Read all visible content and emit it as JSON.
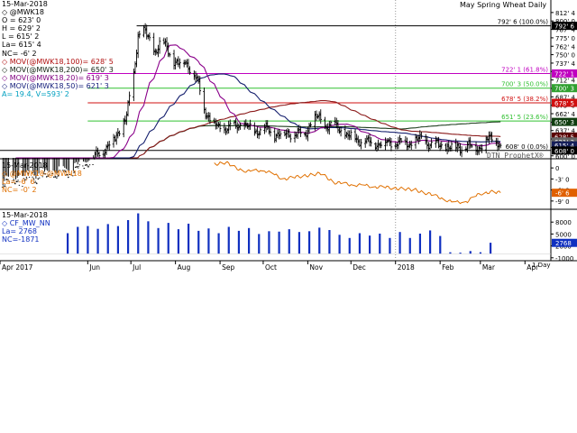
{
  "header": {
    "date": "15-Mar-2018",
    "symbol": "@MWK18",
    "title": "May Spring Wheat Daily"
  },
  "price_legend": {
    "lines": [
      {
        "text": "O = 623' 0",
        "color": "#000000"
      },
      {
        "text": "H = 629' 2",
        "color": "#000000"
      },
      {
        "text": "L = 615' 2",
        "color": "#000000"
      },
      {
        "text": "La= 615' 4",
        "color": "#000000"
      },
      {
        "text": "NC= -6' 2",
        "color": "#000000"
      },
      {
        "text": "MOV(@MWK18,100)= 628' 5",
        "color": "#b01010"
      },
      {
        "text": "MOV(@MWK18,200)= 650' 3",
        "color": "#102010"
      },
      {
        "text": "MOV(@MWK18,20)= 619' 3",
        "color": "#800080"
      },
      {
        "text": "MOV(@MWK18,50)= 621' 3",
        "color": "#1a237e"
      },
      {
        "text": "A= 19.4, V=593' 2",
        "color": "#00a0c0"
      }
    ]
  },
  "spread_legend": {
    "lines": [
      {
        "text": "15-Mar-2018",
        "color": "#000000"
      },
      {
        "text": "@MWK18-@MWN18",
        "color": "#e07000"
      },
      {
        "text": "La= -6' 6",
        "color": "#e07000"
      },
      {
        "text": "NC= -0' 2",
        "color": "#e07000"
      }
    ]
  },
  "oi_legend": {
    "lines": [
      {
        "text": "15-Mar-2018",
        "color": "#000000"
      },
      {
        "text": "CF_MW_NN",
        "color": "#1030c0"
      },
      {
        "text": "La= 2768",
        "color": "#1030c0"
      },
      {
        "text": "NC=-1871",
        "color": "#1030c0"
      }
    ]
  },
  "watermark": "DTN ProphetX®",
  "period_label": "1 Day",
  "colors": {
    "bars": "#000000",
    "ma100": "#8b1a1a",
    "ma200": "#1e3d1e",
    "ma20": "#8a008a",
    "ma50": "#16206e",
    "spread": "#e07000",
    "oi": "#1030c0",
    "badge_price": "#000000",
    "badge_ma100": "#5a0000",
    "badge_ma200": "#0f3d0f",
    "badge_ma20": "#666666",
    "badge_ma50": "#161f5a",
    "badge_spread": "#e06000",
    "badge_oi": "#1030c0"
  },
  "chart_data": [
    {
      "type": "line",
      "subtype": "ohlc-bars",
      "title": "May Spring Wheat Daily",
      "xlabel": "",
      "ylabel": "",
      "ylim": [
        597,
        815
      ],
      "x_tick_labels": [
        "Apr 2017",
        "Jun",
        "Jul",
        "Aug",
        "Sep",
        "Oct",
        "Nov",
        "Dec",
        "2018",
        "Feb",
        "Mar",
        "Apr"
      ],
      "y_tick_labels": [
        "812' 4",
        "800' 0",
        "787' 4",
        "775' 0",
        "762' 4",
        "750' 0",
        "737' 4",
        "725' 0",
        "712' 4",
        "700' 0",
        "687' 4",
        "675' 0",
        "662' 4",
        "650' 0",
        "637' 4",
        "625' 0",
        "612' 4",
        "600' 0"
      ],
      "y_tick_values": [
        812.5,
        800,
        787.5,
        775,
        762.5,
        750,
        737.5,
        725,
        712.5,
        700,
        687.5,
        675,
        662.5,
        650,
        637.5,
        625,
        612.5,
        600
      ],
      "price_anchors": {
        "x": [
          "2017-04-01",
          "2017-05-01",
          "2017-05-20",
          "2017-06-01",
          "2017-06-10",
          "2017-06-20",
          "2017-06-28",
          "2017-07-03",
          "2017-07-06",
          "2017-07-10",
          "2017-07-14",
          "2017-07-18",
          "2017-07-22",
          "2017-07-26",
          "2017-07-31",
          "2017-08-04",
          "2017-08-08",
          "2017-08-12",
          "2017-08-17",
          "2017-08-22",
          "2017-08-28",
          "2017-09-05",
          "2017-09-15",
          "2017-09-25",
          "2017-10-02",
          "2017-10-10",
          "2017-10-20",
          "2017-10-30",
          "2017-11-03",
          "2017-11-08",
          "2017-11-13",
          "2017-11-20",
          "2017-11-28",
          "2017-12-05",
          "2017-12-12",
          "2017-12-20",
          "2018-01-02",
          "2018-01-10",
          "2018-01-18",
          "2018-01-25",
          "2018-02-01",
          "2018-02-10",
          "2018-02-20",
          "2018-02-28",
          "2018-03-05",
          "2018-03-10",
          "2018-03-15"
        ],
        "close": [
          560,
          568,
          575,
          590,
          605,
          625,
          660,
          720,
          780,
          785,
          770,
          755,
          770,
          760,
          740,
          735,
          740,
          728,
          705,
          665,
          645,
          640,
          647,
          637,
          640,
          632,
          633,
          632,
          650,
          657,
          645,
          645,
          630,
          625,
          620,
          618,
          620,
          618,
          625,
          618,
          615,
          612,
          614,
          612,
          622,
          628,
          615.5
        ]
      },
      "moving_average_endpoints": [
        {
          "name": "MOV(@MWK18,100)",
          "value": 628.625
        },
        {
          "name": "MOV(@MWK18,200)",
          "value": 650.375
        },
        {
          "name": "MOV(@MWK18,20)",
          "value": 619.375
        },
        {
          "name": "MOV(@MWK18,50)",
          "value": 621.375
        }
      ],
      "fibonacci_levels": [
        {
          "label": "792' 6 (100.0%)",
          "value": 792.75,
          "color": "#000000"
        },
        {
          "label": "722' 1 (61.8%)",
          "value": 722.125,
          "color": "#c000c0"
        },
        {
          "label": "700' 3 (50.0%)",
          "value": 700.375,
          "color": "#30c030"
        },
        {
          "label": "678' 5 (38.2%)",
          "value": 678.625,
          "color": "#d01010"
        },
        {
          "label": "651' 5 (23.6%)",
          "value": 651.625,
          "color": "#30c030"
        },
        {
          "label": "608' 0 (0.0%)",
          "value": 608,
          "color": "#000000"
        }
      ],
      "axis_badges": [
        {
          "text": "792' 6",
          "value": 792.75,
          "color": "#000000"
        },
        {
          "text": "722' 1",
          "value": 722.125,
          "color": "#c000c0"
        },
        {
          "text": "700' 3",
          "value": 700.375,
          "color": "#30a030"
        },
        {
          "text": "678' 5",
          "value": 678.625,
          "color": "#d01010"
        },
        {
          "text": "650' 3",
          "value": 650.375,
          "color": "#0f3d0f"
        },
        {
          "text": "628' 5",
          "value": 628.625,
          "color": "#5a0000"
        },
        {
          "text": "621' 3",
          "value": 621.375,
          "color": "#666666"
        },
        {
          "text": "615' 4",
          "value": 615.5,
          "color": "#161f5a"
        },
        {
          "text": "608' 0",
          "value": 608,
          "color": "#000000"
        }
      ]
    },
    {
      "type": "line",
      "title": "",
      "series": [
        {
          "name": "@MWK18-@MWN18"
        }
      ],
      "ylim": [
        -11,
        2
      ],
      "y_tick_labels": [
        "0",
        "-3' 0",
        "-6' 0",
        "-9' 0"
      ],
      "y_tick_values": [
        0,
        -3,
        -6,
        -9
      ],
      "anchors": {
        "x": [
          "2017-08-28",
          "2017-09-05",
          "2017-09-12",
          "2017-09-20",
          "2017-10-01",
          "2017-10-15",
          "2017-11-01",
          "2017-11-10",
          "2017-11-20",
          "2017-12-01",
          "2017-12-15",
          "2018-01-01",
          "2018-01-15",
          "2018-02-01",
          "2018-02-10",
          "2018-02-20",
          "2018-03-01",
          "2018-03-08",
          "2018-03-15"
        ],
        "y": [
          1,
          1.5,
          0,
          -1,
          -0.5,
          -3,
          -2,
          -1.5,
          -4,
          -4.5,
          -5,
          -5.5,
          -6,
          -8,
          -9.5,
          -9,
          -7,
          -6.5,
          -6.75
        ]
      },
      "axis_badges": [
        {
          "text": "-6' 6",
          "value": -6.75,
          "color": "#e06000"
        }
      ]
    },
    {
      "type": "bar",
      "title": "",
      "series": [
        {
          "name": "CF_MW_NN"
        }
      ],
      "ylim": [
        -1500,
        11000
      ],
      "y_tick_labels": [
        "8000",
        "5000",
        "2000",
        "-1000"
      ],
      "y_tick_values": [
        8000,
        5000,
        2000,
        -1000
      ],
      "values_x": [
        "2017-05-18",
        "2017-05-25",
        "2017-06-01",
        "2017-06-08",
        "2017-06-15",
        "2017-06-22",
        "2017-06-29",
        "2017-07-06",
        "2017-07-13",
        "2017-07-20",
        "2017-07-27",
        "2017-08-03",
        "2017-08-10",
        "2017-08-17",
        "2017-08-24",
        "2017-08-31",
        "2017-09-07",
        "2017-09-14",
        "2017-09-21",
        "2017-09-28",
        "2017-10-05",
        "2017-10-12",
        "2017-10-19",
        "2017-10-26",
        "2017-11-02",
        "2017-11-09",
        "2017-11-16",
        "2017-11-23",
        "2017-11-30",
        "2017-12-07",
        "2017-12-14",
        "2017-12-21",
        "2017-12-28",
        "2018-01-04",
        "2018-01-11",
        "2018-01-18",
        "2018-01-25",
        "2018-02-01",
        "2018-02-08",
        "2018-02-15",
        "2018-02-22",
        "2018-03-01",
        "2018-03-08"
      ],
      "values": [
        5200,
        6800,
        7000,
        6300,
        7500,
        7000,
        8500,
        10200,
        8200,
        6500,
        7800,
        6200,
        7600,
        5800,
        6400,
        5200,
        6800,
        5800,
        6500,
        5000,
        5700,
        5600,
        6200,
        5500,
        5700,
        6600,
        6000,
        4800,
        4000,
        5200,
        4600,
        5100,
        4000,
        5500,
        4000,
        5100,
        5900,
        4500,
        400,
        300,
        700,
        400,
        2800
      ],
      "axis_badges": [
        {
          "text": "2768",
          "value": 2768,
          "color": "#1030c0"
        }
      ]
    }
  ]
}
